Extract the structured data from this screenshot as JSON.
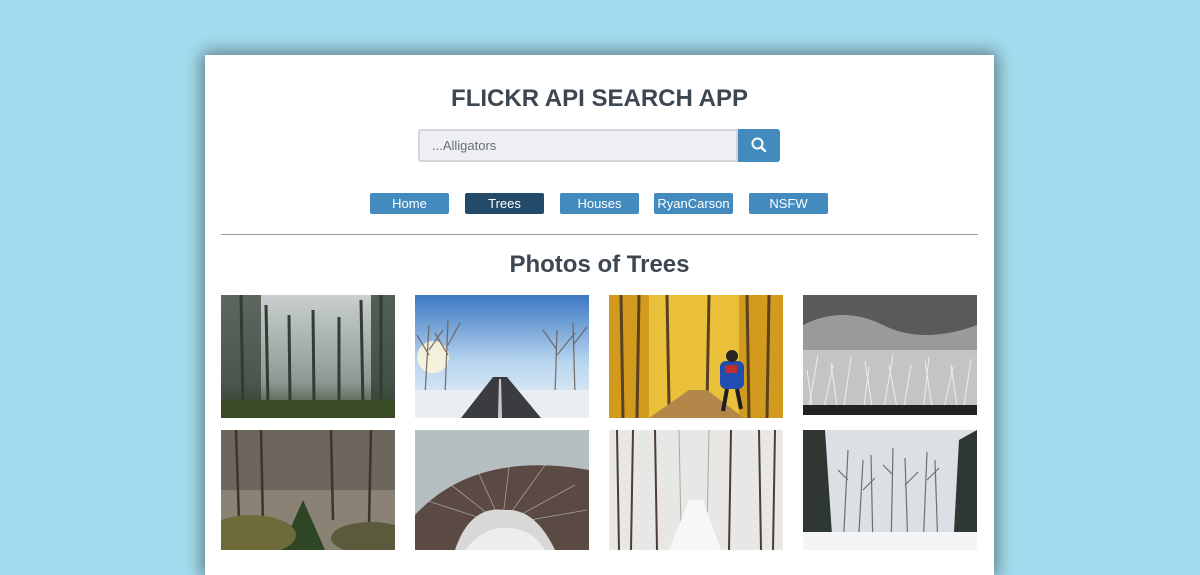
{
  "app": {
    "title": "FLICKR API SEARCH APP"
  },
  "search": {
    "placeholder": "...Alligators",
    "button_icon": "search-icon"
  },
  "nav": {
    "items": [
      {
        "label": "Home",
        "active": false
      },
      {
        "label": "Trees",
        "active": true
      },
      {
        "label": "Houses",
        "active": false
      },
      {
        "label": "RyanCarson",
        "active": false
      },
      {
        "label": "NSFW",
        "active": false
      }
    ]
  },
  "gallery": {
    "heading": "Photos of Trees",
    "photos": [
      {
        "subject": "foggy pine forest"
      },
      {
        "subject": "snowy road with frosted trees"
      },
      {
        "subject": "autumn forest runner"
      },
      {
        "subject": "black and white frosted meadow"
      },
      {
        "subject": "mossy forest"
      },
      {
        "subject": "tree stump close-up"
      },
      {
        "subject": "snowy forest path"
      },
      {
        "subject": "snow-covered forest"
      }
    ]
  },
  "colors": {
    "background": "#a3dcee",
    "accent": "#438bbf",
    "active": "#234b69",
    "text": "#3c4752"
  }
}
